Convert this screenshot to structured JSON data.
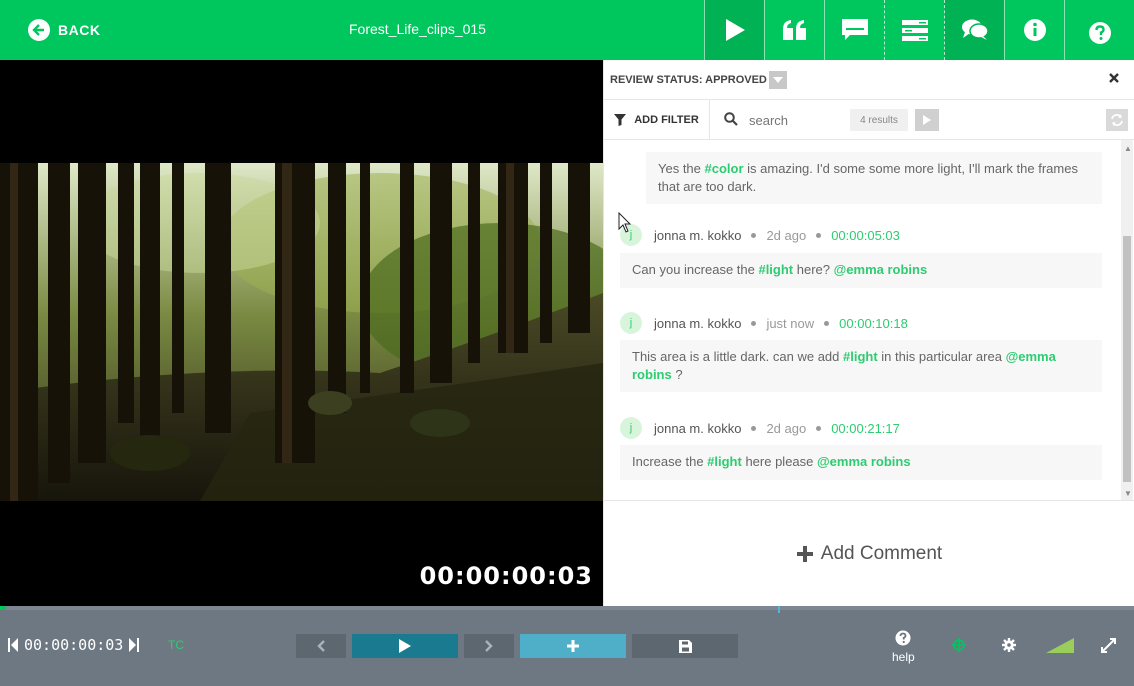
{
  "header": {
    "back_label": "BACK",
    "title": "Forest_Life_clips_015",
    "tools": [
      {
        "name": "play-icon"
      },
      {
        "name": "quote-icon"
      },
      {
        "name": "subtitle-icon"
      },
      {
        "name": "list-icon"
      },
      {
        "name": "chat-icon"
      },
      {
        "name": "info-icon"
      },
      {
        "name": "help-icon"
      }
    ]
  },
  "video": {
    "timecode": "00:00:00:03"
  },
  "panel": {
    "review_status": "REVIEW STATUS: APPROVED",
    "add_filter": "ADD FILTER",
    "search_placeholder": "search",
    "results": "4 results",
    "add_comment": "Add Comment",
    "comments": [
      {
        "text_parts": [
          "Yes the ",
          "#color",
          " is amazing. I'd some some more light, I'll mark the frames that are too dark."
        ]
      },
      {
        "avatar": "j",
        "author": "jonna m. kokko",
        "ago": "2d ago",
        "time": "00:00:05:03",
        "text_parts": [
          "Can you increase the ",
          "#light",
          " here? ",
          "@emma robins"
        ]
      },
      {
        "avatar": "j",
        "author": "jonna m. kokko",
        "ago": "just now",
        "time": "00:00:10:18",
        "text_parts": [
          "This area is a little dark. can we add ",
          "#light",
          " in this particular area ",
          "@emma robins",
          " ?"
        ]
      },
      {
        "avatar": "j",
        "author": "jonna m. kokko",
        "ago": "2d ago",
        "time": "00:00:21:17",
        "text_parts": [
          "Increase the ",
          "#light",
          " here please ",
          "@emma robins"
        ]
      }
    ]
  },
  "player": {
    "timecode": "00:00:00:03",
    "tc_label": "TC",
    "help_label": "help",
    "progress_fraction": 0.005,
    "accent_green": "#00c65e",
    "play_color": "#1a7a90",
    "add_color": "#4fafc9"
  }
}
